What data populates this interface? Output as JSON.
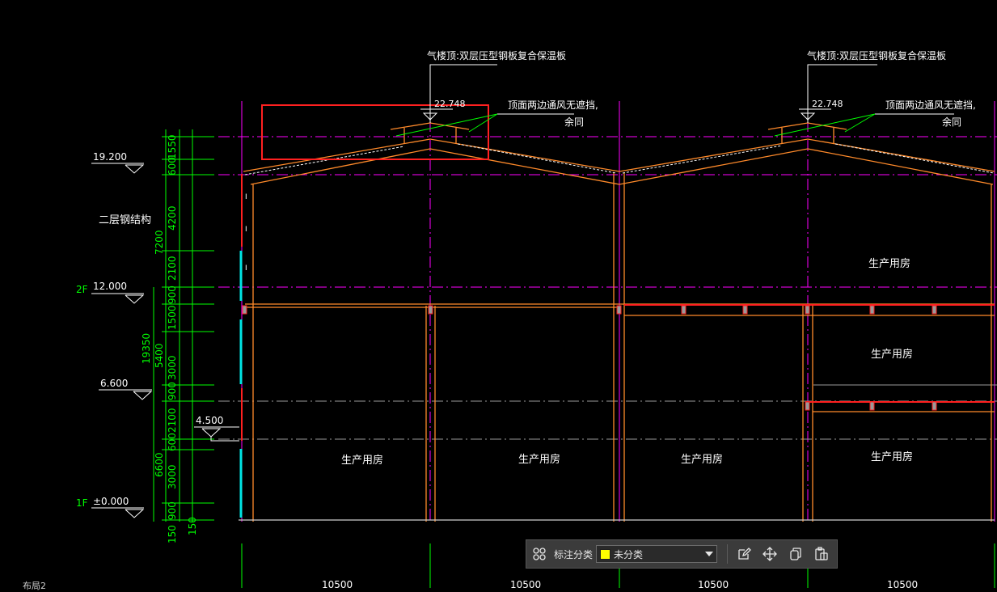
{
  "drawing": {
    "roof_note_left": "气楼顶:双层压型钢板复合保温板",
    "roof_note_right": "气楼顶:双层压型钢板复合保温板",
    "vent_note_left_1": "顶面两边通风无遮挡,",
    "vent_note_left_2": "余同",
    "vent_note_right_1": "顶面两边通风无遮挡,",
    "vent_note_right_2": "余同",
    "elev_top_left": "22.748",
    "elev_top_right": "22.748",
    "level_19200": "19.200",
    "level_12000": "12.000",
    "level_6600": "6.600",
    "level_4500": "4.500",
    "level_0": "±0.000",
    "floor_2f": "2F",
    "floor_1f": "1F",
    "structure_label": "二层钢结构",
    "room_label": "生产用房",
    "dim_1550": "1550",
    "dim_600a": "600",
    "dim_4200": "4200",
    "dim_2100a": "2100",
    "dim_900a": "900",
    "dim_1500": "1500",
    "dim_7200": "7200",
    "dim_19350": "19350",
    "dim_5400": "5400",
    "dim_3000a": "3000",
    "dim_900b": "900",
    "dim_2100b": "2100",
    "dim_600b": "600",
    "dim_6600": "6600",
    "dim_3000b": "3000",
    "dim_900c": "900",
    "dim_150a": "150",
    "dim_150b": "150",
    "span_1": "10500",
    "span_2": "10500",
    "span_3": "10500",
    "span_4": "10500"
  },
  "toolbar": {
    "annotation_class_label": "标注分类",
    "selected_class": "未分类",
    "swatch_color": "#ffff00"
  },
  "layout_tab": "布局2",
  "colors": {
    "background": "#000000",
    "structure": "#ff8a2a",
    "dimension": "#00ff00",
    "axis": "#ff00ff",
    "highlight": "#ff2020",
    "glass": "#00e5e5"
  }
}
